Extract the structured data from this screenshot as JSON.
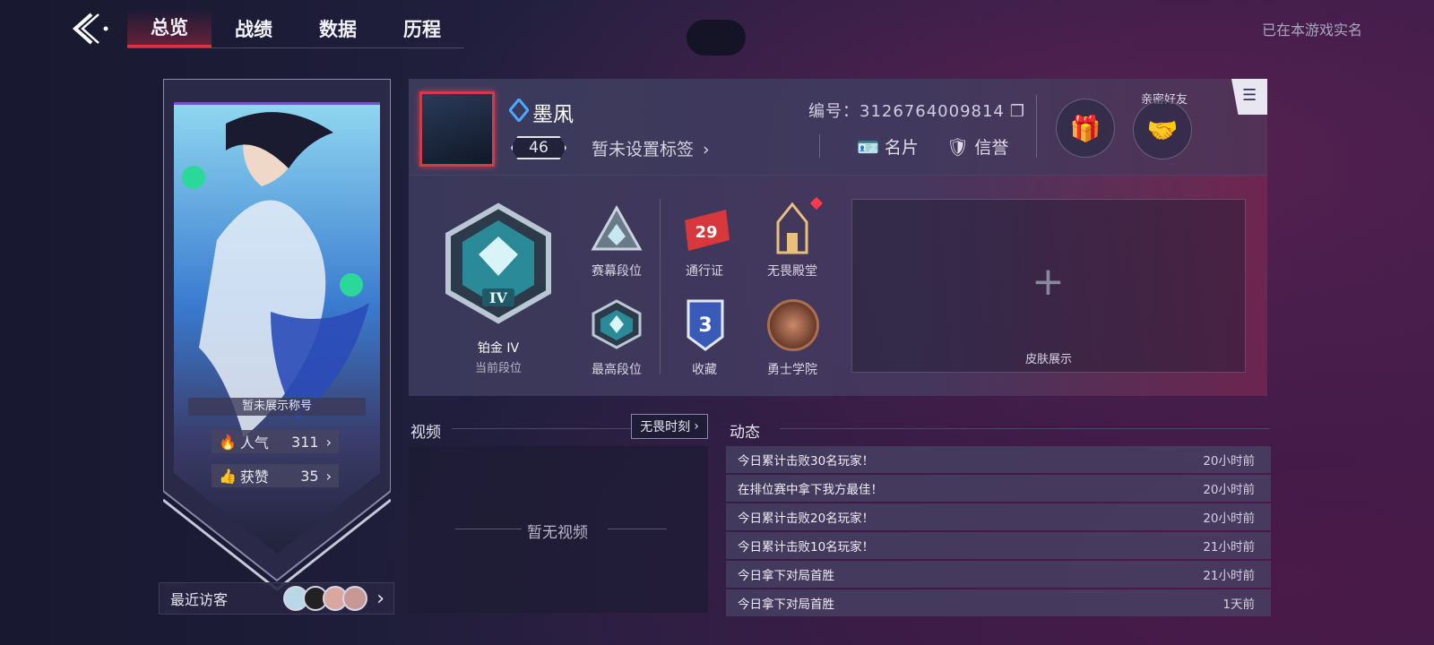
{
  "nav": {
    "tabs": [
      "总览",
      "战绩",
      "数据",
      "历程"
    ],
    "realname": "已在本游戏实名"
  },
  "banner": {
    "title": "暂未展示称号",
    "popularity_label": "人气",
    "popularity": "311",
    "likes_label": "获赞",
    "likes": "35"
  },
  "visitors": {
    "label": "最近访客"
  },
  "profile": {
    "name": "墨凩",
    "level": "46",
    "tag": "暂未设置标签",
    "uid": "编号：3126764009814",
    "card_label": "名片",
    "credit_label": "信誉",
    "friend_label": "亲密好友"
  },
  "rank": {
    "current_label": "当前段位",
    "current_name": "铂金 IV",
    "badge_numeral": "IV",
    "season_label": "赛幕段位",
    "highest_label": "最高段位"
  },
  "features": {
    "pass_label": "通行证",
    "pass_level": "29",
    "hall_label": "无畏殿堂",
    "collection_label": "收藏",
    "collection_count": "3",
    "academy_label": "勇士学院"
  },
  "skin": {
    "label": "皮肤展示"
  },
  "video": {
    "title": "视频",
    "link": "无畏时刻",
    "empty": "暂无视频"
  },
  "feed": {
    "title": "动态",
    "items": [
      {
        "text": "今日累计击败30名玩家！",
        "time": "20小时前"
      },
      {
        "text": "在排位赛中拿下我方最佳！",
        "time": "20小时前"
      },
      {
        "text": "今日累计击败20名玩家！",
        "time": "20小时前"
      },
      {
        "text": "今日累计击败10名玩家！",
        "time": "21小时前"
      },
      {
        "text": "今日拿下对局首胜",
        "time": "21小时前"
      },
      {
        "text": "今日拿下对局首胜",
        "time": "1天前"
      }
    ]
  },
  "colors": {
    "accent_red": "#d8354a",
    "teal": "#3fd0d8"
  }
}
